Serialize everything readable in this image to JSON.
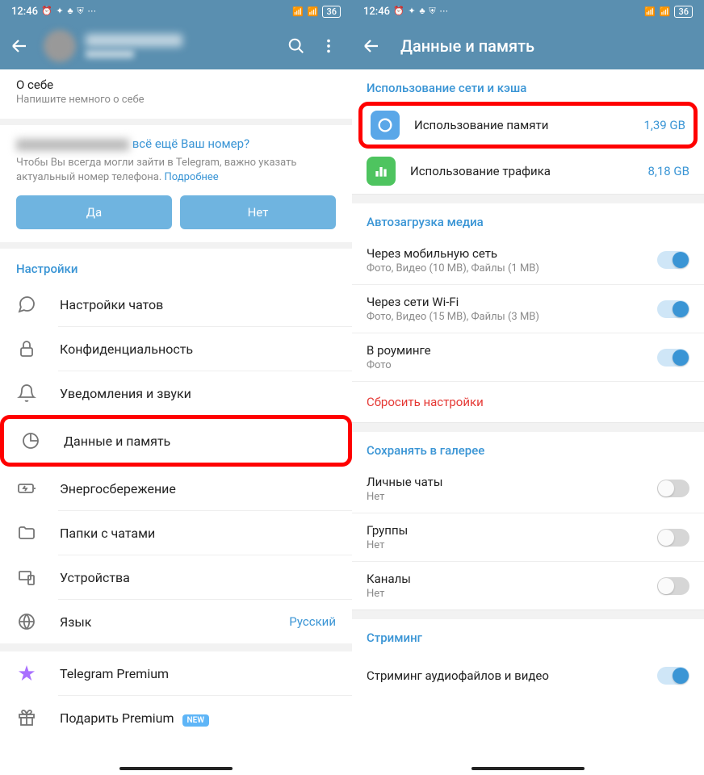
{
  "status": {
    "time": "12:46",
    "icons_left": "⏰ ✂ ✿ ✖ ⋯",
    "icons_right": "📶 📶 36",
    "battery": "36"
  },
  "left": {
    "about": {
      "title": "О себе",
      "sub": "Напишите немного о себе"
    },
    "number": {
      "question": "всё ещё Ваш номер?",
      "desc": "Чтобы Вы всегда могли зайти в Telegram, важно указать актуальный номер телефона. ",
      "more": "Подробнее",
      "yes": "Да",
      "no": "Нет"
    },
    "settings_title": "Настройки",
    "settings": {
      "chats": "Настройки чатов",
      "privacy": "Конфиденциальность",
      "notifications": "Уведомления и звуки",
      "data": "Данные и память",
      "power": "Энергосбережение",
      "folders": "Папки с чатами",
      "devices": "Устройства",
      "language": "Язык",
      "language_value": "Русский",
      "premium": "Telegram Premium",
      "gift": "Подарить Premium",
      "new_badge": "NEW"
    }
  },
  "right": {
    "header": "Данные и память",
    "usage_title": "Использование сети и кэша",
    "memory": {
      "label": "Использование памяти",
      "value": "1,39 GB"
    },
    "traffic": {
      "label": "Использование трафика",
      "value": "8,18 GB"
    },
    "autoload_title": "Автозагрузка медиа",
    "mobile": {
      "title": "Через мобильную сеть",
      "sub": "Фото, Видео (10 МВ), Файлы (1 МВ)"
    },
    "wifi": {
      "title": "Через сети Wi-Fi",
      "sub": "Фото, Видео (15 МВ), Файлы (3 МВ)"
    },
    "roaming": {
      "title": "В роуминге",
      "sub": "Фото"
    },
    "reset": "Сбросить настройки",
    "gallery_title": "Сохранять в галерее",
    "private": {
      "title": "Личные чаты",
      "sub": "Нет"
    },
    "groups": {
      "title": "Группы",
      "sub": "Нет"
    },
    "channels": {
      "title": "Каналы",
      "sub": "Нет"
    },
    "streaming_title": "Стриминг",
    "streaming": {
      "title": "Стриминг аудиофайлов и видео"
    }
  }
}
